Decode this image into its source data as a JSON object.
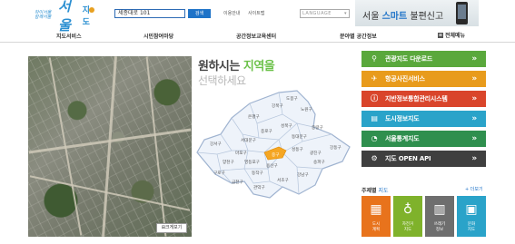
{
  "header": {
    "logo": {
      "tagline_line1": "하이서울",
      "tagline_line2": "함께서울",
      "brand": "서울",
      "suffix": "지도"
    },
    "search": {
      "value": "세종대로 101",
      "button_label": "검색"
    },
    "links": [
      "이용안내",
      "사이트맵"
    ],
    "language_select": "LANGUAGE",
    "banner": {
      "text_before": "서울 ",
      "text_highlight": "스마트",
      "text_after": " 불편신고"
    }
  },
  "nav": {
    "items": [
      "지도서비스",
      "시민참여마당",
      "공간정보교육센터",
      "분야별 공간정보"
    ],
    "all_menu_label": "전체메뉴"
  },
  "aerial": {
    "zoom_button_label": "크게보기"
  },
  "map": {
    "title_part1": "원하시는 ",
    "title_highlight": "지역을",
    "subtitle": "선택하세요",
    "districts": [
      "도봉구",
      "노원구",
      "강북구",
      "성북구",
      "중랑구",
      "은평구",
      "종로구",
      "동대문구",
      "서대문구",
      "중구",
      "성동구",
      "광진구",
      "마포구",
      "용산구",
      "강동구",
      "강서구",
      "양천구",
      "영등포구",
      "동작구",
      "서초구",
      "강남구",
      "송파구",
      "구로구",
      "금천구",
      "관악구"
    ],
    "selected_district": "중구"
  },
  "menu": {
    "items": [
      {
        "label": "관광지도 다운로드",
        "color": "#5aa83c",
        "icon": "location-pin-icon",
        "glyph": "⚲"
      },
      {
        "label": "항공사진서비스",
        "color": "#e89b1c",
        "icon": "airplane-icon",
        "glyph": "✈"
      },
      {
        "label": "지반정보통합관리시스템",
        "color": "#d9452b",
        "icon": "info-icon",
        "glyph": "ⓘ"
      },
      {
        "label": "도시정보지도",
        "color": "#2aa3c9",
        "icon": "document-icon",
        "glyph": "▤"
      },
      {
        "label": "서울통계지도",
        "color": "#2f8f4e",
        "icon": "pie-chart-icon",
        "glyph": "◔"
      },
      {
        "label": "지도 OPEN API",
        "color": "#3f3f3f",
        "icon": "gear-icon",
        "glyph": "⚙"
      }
    ],
    "arrow": "»"
  },
  "theme": {
    "title": "주제별",
    "title_sub": " 지도",
    "more_label": "+ 더보기",
    "tiles": [
      {
        "label": "도시\n계획",
        "color": "#e8731c",
        "glyph": "▦"
      },
      {
        "label": "자전거\n지도",
        "color": "#7fb22b",
        "glyph": "♁"
      },
      {
        "label": "쓰레기\n정보",
        "color": "#6e6e6e",
        "glyph": "▥"
      },
      {
        "label": "문화\n지도",
        "color": "#2aa3c9",
        "glyph": "▣"
      }
    ]
  },
  "colors": {
    "brand_blue": "#1e73c8",
    "highlight_green": "#6cc24a",
    "selected_district": "#f5a623",
    "district_fill": "#eef3fa",
    "district_stroke": "#9fb3d0"
  }
}
